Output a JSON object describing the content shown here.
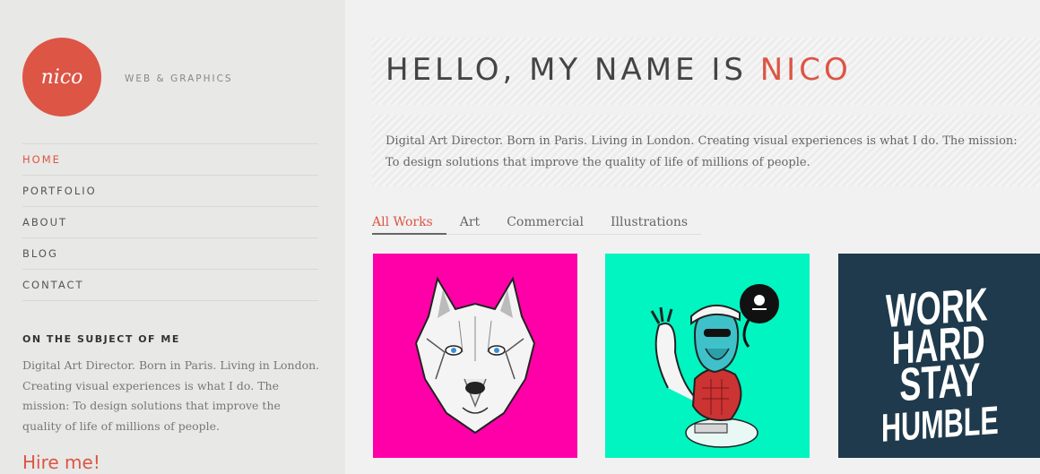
{
  "logo": {
    "text": "nico",
    "tagline": "WEB & GRAPHICS",
    "color": "#dc5545"
  },
  "nav": [
    {
      "label": "HOME",
      "active": true
    },
    {
      "label": "PORTFOLIO"
    },
    {
      "label": "ABOUT"
    },
    {
      "label": "BLOG"
    },
    {
      "label": "CONTACT"
    }
  ],
  "about": {
    "heading": "ON THE SUBJECT OF ME",
    "text": "Digital Art Director. Born in Paris. Living in London. Creating visual experiences is what I do. The mission: To design solutions that improve the quality of life of millions of people.",
    "hire": "Hire me!"
  },
  "hero": {
    "title_prefix": "HELLO, MY NAME IS ",
    "title_name": "NICO"
  },
  "intro": "Digital Art Director. Born in Paris. Living in London. Creating visual experiences is what I do. The mission: To design solutions that improve the quality of life of millions of people.",
  "filters": [
    {
      "label": "All Works",
      "active": true
    },
    {
      "label": "Art"
    },
    {
      "label": "Commercial"
    },
    {
      "label": "Illustrations"
    }
  ],
  "portfolio": [
    {
      "name": "wolf",
      "bg": "#ff00a8"
    },
    {
      "name": "hipster",
      "bg": "#00f5c0"
    },
    {
      "name": "typography",
      "bg": "#1e3a4c",
      "lines": [
        "WORK",
        "HARD",
        "STAY",
        "HUMBLE"
      ]
    }
  ],
  "colors": {
    "accent": "#dc5545",
    "sidebar": "#e8e8e6"
  }
}
